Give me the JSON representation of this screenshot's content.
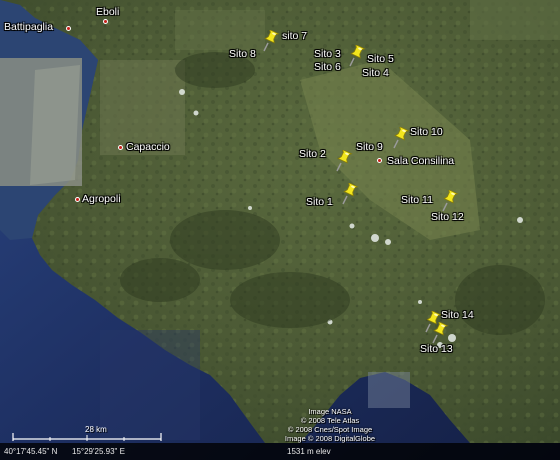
{
  "towns": [
    {
      "id": "battipaglia",
      "name": "Battipaglia"
    },
    {
      "id": "eboli",
      "name": "Eboli"
    },
    {
      "id": "capaccio",
      "name": "Capaccio"
    },
    {
      "id": "agropoli",
      "name": "Agropoli"
    },
    {
      "id": "sala-consilina",
      "name": "Sala Consilina"
    }
  ],
  "sites": {
    "s1": "Sito 1",
    "s2": "Sito 2",
    "s3": "Sito 3",
    "s4": "Sito 4",
    "s5": "Sito 5",
    "s6": "Sito 6",
    "s7": "sito 7",
    "s8": "Sito 8",
    "s9": "Sito 9",
    "s10": "Sito 10",
    "s11": "Sito 11",
    "s12": "Sito 12",
    "s13": "Sito 13",
    "s14": "Sito 14"
  },
  "credits": {
    "line1": "Image NASA",
    "line2": "© 2008 Tele Atlas",
    "line3": "© 2008 Cnes/Spot Image",
    "line4": "Image © 2008 DigitalGlobe"
  },
  "scale": {
    "label": "28 km"
  },
  "status": {
    "latitude": "40°17'45.45\" N",
    "longitude": "15°29'25.93\" E",
    "elevation": "1531 m elev"
  },
  "colors": {
    "sea": "#1d2e57",
    "land": "#4c5a36",
    "pin": "#f2e61d",
    "town_dot": "#c8201a"
  }
}
